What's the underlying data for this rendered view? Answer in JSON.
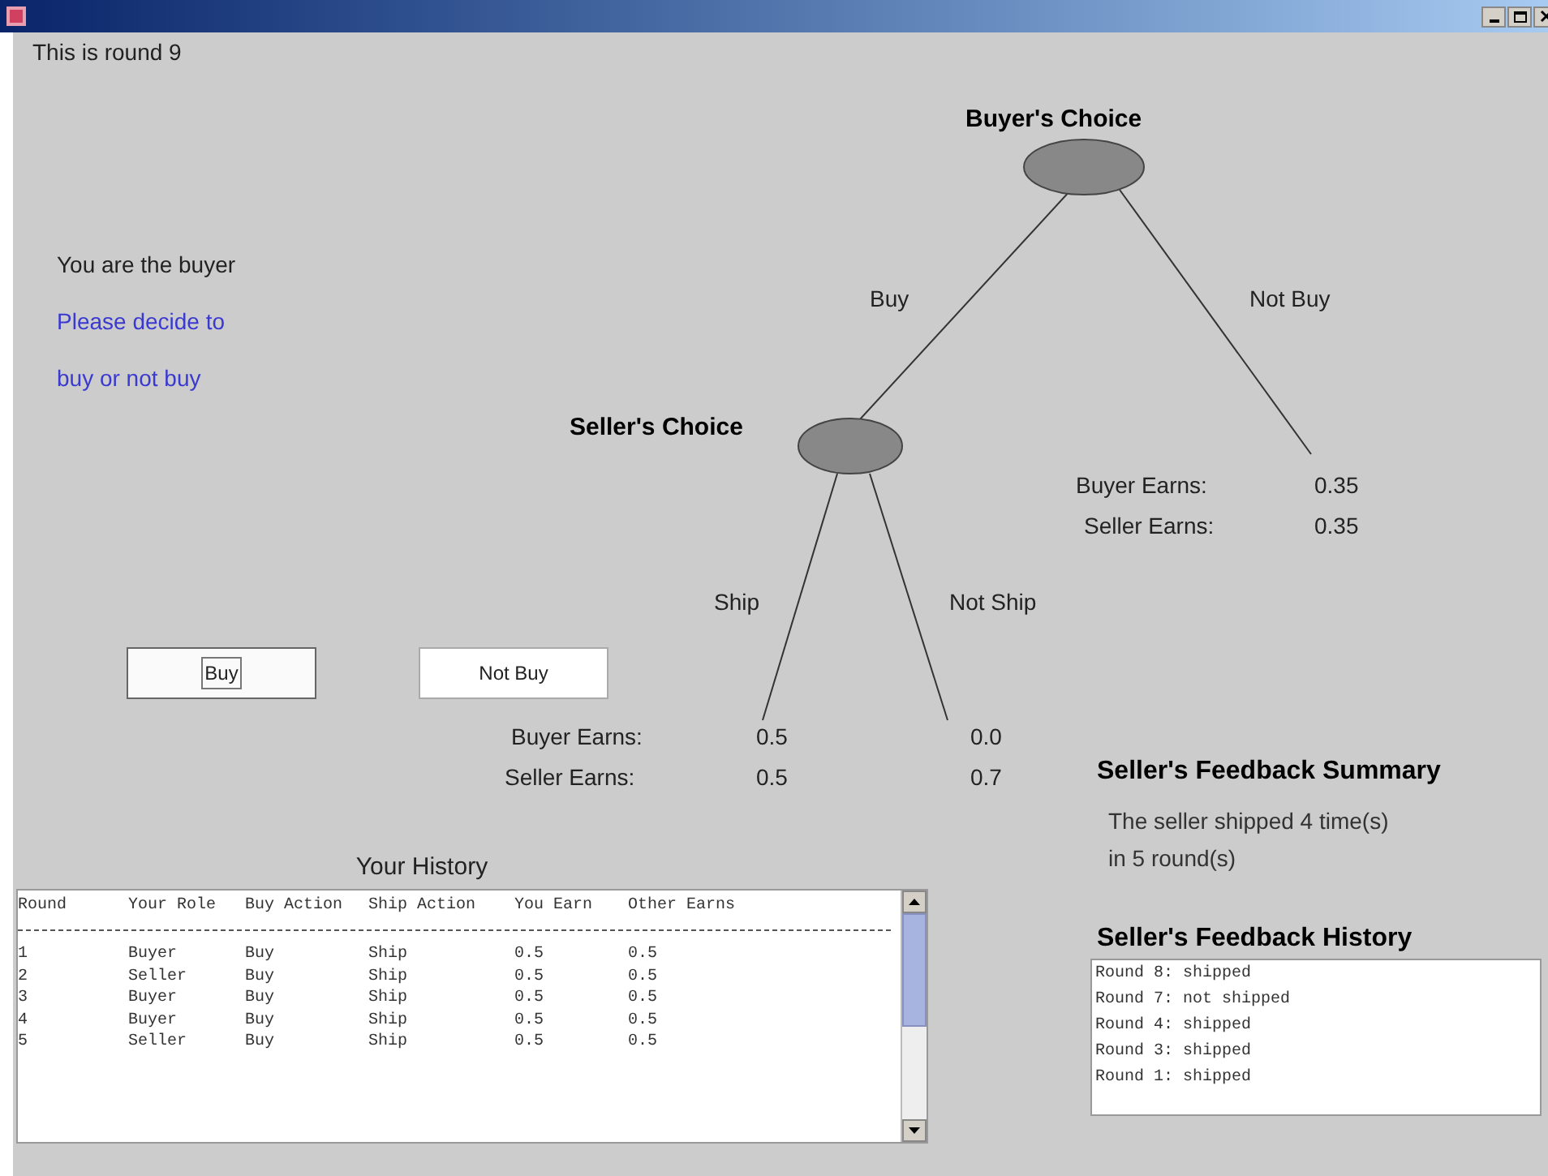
{
  "round_label": "This is round 9",
  "role_text": "You are the buyer",
  "instruction_lines": [
    "Please decide to",
    "buy or not buy"
  ],
  "buttons": [
    {
      "label": "Buy",
      "focused": true
    },
    {
      "label": "Not Buy",
      "focused": false
    }
  ],
  "tree": {
    "buyer_node": "Buyer's Choice",
    "seller_node": "Seller's Choice",
    "branches": {
      "buy": "Buy",
      "not_buy": "Not Buy",
      "ship": "Ship",
      "not_ship": "Not Ship"
    },
    "payoffs": {
      "not_buy": {
        "buyer_label": "Buyer Earns:",
        "buyer_value": "0.35",
        "seller_label": "Seller Earns:",
        "seller_value": "0.35"
      },
      "ship": {
        "buyer_label": "Buyer Earns:",
        "buyer_value": "0.5",
        "seller_label": "Seller Earns:",
        "seller_value": "0.5"
      },
      "not_ship": {
        "buyer_value": "0.0",
        "seller_value": "0.7"
      }
    }
  },
  "history": {
    "title": "Your History",
    "columns": [
      "Round",
      "Your Role",
      "Buy Action",
      "Ship Action",
      "You Earn",
      "Other Earns"
    ],
    "rows": [
      [
        "1",
        "Buyer",
        "Buy",
        "Ship",
        "0.5",
        "0.5"
      ],
      [
        "2",
        "Seller",
        "Buy",
        "Ship",
        "0.5",
        "0.5"
      ],
      [
        "3",
        "Buyer",
        "Buy",
        "Ship",
        "0.5",
        "0.5"
      ],
      [
        "4",
        "Buyer",
        "Buy",
        "Ship",
        "0.5",
        "0.5"
      ],
      [
        "5",
        "Seller",
        "Buy",
        "Ship",
        "0.5",
        "0.5"
      ]
    ]
  },
  "feedback_summary": {
    "title": "Seller's Feedback Summary",
    "lines": [
      "The seller shipped 4 time(s)",
      "in 5 round(s)"
    ]
  },
  "feedback_history": {
    "title": "Seller's Feedback History",
    "entries": [
      "Round 8: shipped",
      "Round 7: not shipped",
      "Round 4: shipped",
      "Round 3: shipped",
      "Round 1: shipped"
    ]
  }
}
